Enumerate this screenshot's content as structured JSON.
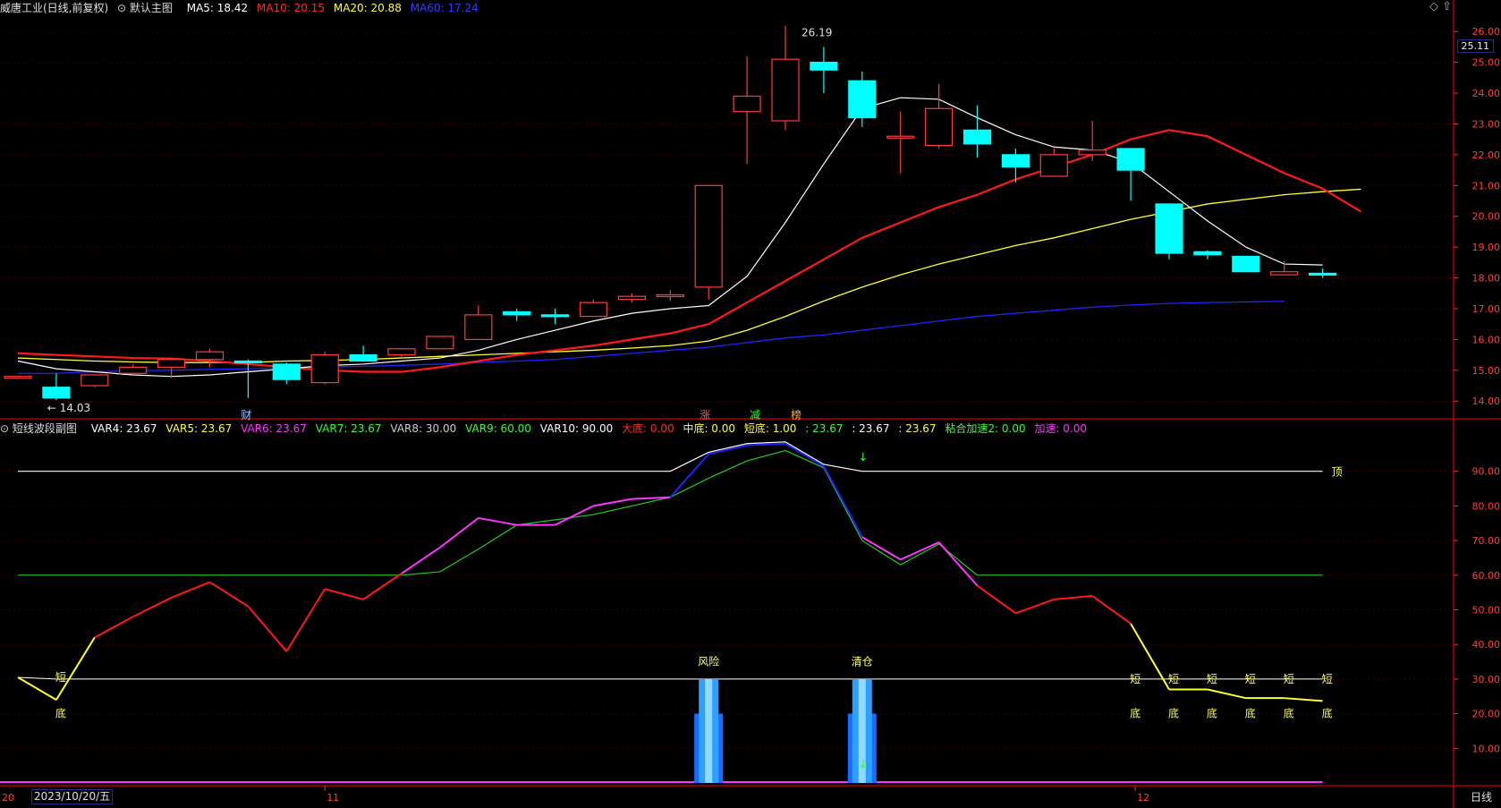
{
  "main_header": {
    "stock_name": "威唐工业(日线,前复权)",
    "template": "默认主图",
    "ma5": "MA5: 18.42",
    "ma10": "MA10: 20.15",
    "ma20": "MA20: 20.88",
    "ma60": "MA60: 17.24"
  },
  "sub_header": {
    "indicator": "短线波段副图",
    "var4": "VAR4: 23.67",
    "var5": "VAR5: 23.67",
    "var6": "VAR6: 23.67",
    "var7": "VAR7: 23.67",
    "var8": "VAR8: 30.00",
    "var9": "VAR9: 60.00",
    "var10": "VAR10: 90.00",
    "dadi": "大底: 0.00",
    "zhongdi": "中底: 0.00",
    "duandi": "短底: 1.00",
    "v1": ": 23.67",
    "v2": ": 23.67",
    "v3": ": 23.67",
    "nianhe": "粘合加速2: 0.00",
    "jiasu": "加速: 0.00"
  },
  "current_price": "25.11",
  "date_box": "2023/10/20/五",
  "period": "日线",
  "x_axis_labels": [
    "20",
    "11",
    "12"
  ],
  "price_axis": [
    "26.00",
    "25.00",
    "24.00",
    "23.00",
    "22.00",
    "21.00",
    "20.00",
    "19.00",
    "18.00",
    "17.00",
    "16.00",
    "15.00",
    "14.00"
  ],
  "sub_axis": [
    "90.00",
    "80.00",
    "70.00",
    "60.00",
    "50.00",
    "40.00",
    "30.00",
    "20.00",
    "10.00"
  ],
  "annotations": {
    "high": "26.19",
    "low": "14.03",
    "cai": "财",
    "zhang": "涨",
    "jian": "减",
    "bang": "榜",
    "ding": "顶",
    "fengxian": "风险",
    "qingcang": "清仓",
    "duan": "短",
    "di": "底"
  },
  "colors": {
    "up": "#ff3b3b",
    "down": "#00ffff",
    "ma5": "#ffffff",
    "ma10": "#ff1a1a",
    "ma20": "#ffff33",
    "ma60": "#2323ff",
    "grid": "#3a0000",
    "axis": "#ff2a2a"
  },
  "chart_data": {
    "type": "candlestick",
    "ylim": [
      13.6,
      26.5
    ],
    "candles": [
      {
        "o": 14.75,
        "h": 14.75,
        "l": 14.75,
        "c": 14.8
      },
      {
        "o": 14.45,
        "h": 14.9,
        "l": 14.03,
        "c": 14.1
      },
      {
        "o": 14.5,
        "h": 14.85,
        "l": 14.45,
        "c": 14.85
      },
      {
        "o": 14.9,
        "h": 15.2,
        "l": 14.85,
        "c": 15.1
      },
      {
        "o": 15.1,
        "h": 15.4,
        "l": 14.75,
        "c": 15.35
      },
      {
        "o": 15.35,
        "h": 15.7,
        "l": 15.1,
        "c": 15.6
      },
      {
        "o": 15.3,
        "h": 15.35,
        "l": 14.1,
        "c": 15.25
      },
      {
        "o": 15.2,
        "h": 15.25,
        "l": 14.55,
        "c": 14.7
      },
      {
        "o": 14.6,
        "h": 15.6,
        "l": 14.55,
        "c": 15.5
      },
      {
        "o": 15.5,
        "h": 15.8,
        "l": 15.3,
        "c": 15.3
      },
      {
        "o": 15.5,
        "h": 15.7,
        "l": 15.4,
        "c": 15.7
      },
      {
        "o": 15.7,
        "h": 16.1,
        "l": 15.7,
        "c": 16.1
      },
      {
        "o": 16.0,
        "h": 17.1,
        "l": 16.0,
        "c": 16.8
      },
      {
        "o": 16.9,
        "h": 17.0,
        "l": 16.6,
        "c": 16.8
      },
      {
        "o": 16.8,
        "h": 17.0,
        "l": 16.5,
        "c": 16.75
      },
      {
        "o": 16.75,
        "h": 17.3,
        "l": 16.75,
        "c": 17.2
      },
      {
        "o": 17.3,
        "h": 17.5,
        "l": 17.2,
        "c": 17.4
      },
      {
        "o": 17.4,
        "h": 17.6,
        "l": 17.25,
        "c": 17.45
      },
      {
        "o": 17.7,
        "h": 21.0,
        "l": 17.3,
        "c": 21.0
      },
      {
        "o": 23.4,
        "h": 25.2,
        "l": 21.7,
        "c": 23.9
      },
      {
        "o": 23.1,
        "h": 26.19,
        "l": 22.8,
        "c": 25.1
      },
      {
        "o": 25.0,
        "h": 25.5,
        "l": 24.0,
        "c": 24.75
      },
      {
        "o": 24.4,
        "h": 24.7,
        "l": 22.9,
        "c": 23.2
      },
      {
        "o": 22.6,
        "h": 23.4,
        "l": 21.4,
        "c": 22.6
      },
      {
        "o": 22.3,
        "h": 24.3,
        "l": 22.2,
        "c": 23.5
      },
      {
        "o": 22.8,
        "h": 23.6,
        "l": 21.9,
        "c": 22.35
      },
      {
        "o": 22.0,
        "h": 22.2,
        "l": 21.1,
        "c": 21.6
      },
      {
        "o": 21.3,
        "h": 22.2,
        "l": 21.3,
        "c": 22.0
      },
      {
        "o": 22.0,
        "h": 23.1,
        "l": 21.8,
        "c": 22.15
      },
      {
        "o": 22.2,
        "h": 22.2,
        "l": 20.5,
        "c": 21.5
      },
      {
        "o": 20.4,
        "h": 20.4,
        "l": 18.6,
        "c": 18.8
      },
      {
        "o": 18.85,
        "h": 18.9,
        "l": 18.6,
        "c": 18.75
      },
      {
        "o": 18.7,
        "h": 18.7,
        "l": 18.2,
        "c": 18.2
      },
      {
        "o": 18.1,
        "h": 18.55,
        "l": 18.1,
        "c": 18.2
      },
      {
        "o": 18.15,
        "h": 18.3,
        "l": 18.0,
        "c": 18.1
      }
    ],
    "ma5": [
      15.3,
      15.05,
      14.95,
      14.85,
      14.8,
      14.85,
      14.95,
      15.05,
      15.15,
      15.2,
      15.3,
      15.4,
      15.65,
      16.0,
      16.3,
      16.6,
      16.85,
      17.0,
      17.1,
      18.05,
      19.8,
      21.7,
      23.5,
      23.85,
      23.8,
      23.2,
      22.65,
      22.25,
      22.15,
      21.75,
      20.8,
      19.85,
      19.0,
      18.45,
      18.42
    ],
    "ma10": [
      15.55,
      15.5,
      15.45,
      15.4,
      15.38,
      15.3,
      15.2,
      15.1,
      15.0,
      14.95,
      14.95,
      15.1,
      15.3,
      15.5,
      15.65,
      15.8,
      16.0,
      16.2,
      16.5,
      17.2,
      17.9,
      18.6,
      19.3,
      19.8,
      20.3,
      20.7,
      21.2,
      21.6,
      22.0,
      22.5,
      22.8,
      22.6,
      22.0,
      21.4,
      20.9,
      20.15
    ],
    "ma20": [
      15.4,
      15.35,
      15.3,
      15.27,
      15.25,
      15.25,
      15.25,
      15.3,
      15.32,
      15.35,
      15.4,
      15.45,
      15.5,
      15.55,
      15.6,
      15.65,
      15.72,
      15.8,
      15.95,
      16.3,
      16.75,
      17.25,
      17.7,
      18.1,
      18.45,
      18.75,
      19.05,
      19.3,
      19.6,
      19.9,
      20.15,
      20.4,
      20.55,
      20.7,
      20.8,
      20.88
    ],
    "ma60": [
      14.9,
      14.9,
      14.95,
      14.98,
      15.0,
      15.03,
      15.05,
      15.08,
      15.1,
      15.13,
      15.16,
      15.2,
      15.25,
      15.3,
      15.35,
      15.45,
      15.55,
      15.65,
      15.75,
      15.9,
      16.05,
      16.15,
      16.3,
      16.45,
      16.6,
      16.75,
      16.85,
      16.95,
      17.05,
      17.12,
      17.17,
      17.2,
      17.22,
      17.24
    ],
    "sub_ylim": [
      0,
      100
    ],
    "sub_var_main": [
      30.5,
      24,
      42,
      48,
      53.5,
      58,
      51,
      38,
      56,
      53,
      60.5,
      68,
      76.5,
      74.5,
      74.5,
      80,
      82,
      82.5,
      95,
      97.5,
      98,
      91.5,
      71,
      64.5,
      69.5,
      57,
      49,
      53,
      54,
      46,
      27,
      27,
      24.5,
      24.5,
      23.67
    ],
    "sub_var9": [
      60,
      60,
      60,
      60,
      60,
      60,
      60,
      60,
      60,
      60,
      60,
      61,
      67.5,
      74.5,
      76,
      77.5,
      80,
      82.5,
      88,
      93,
      96,
      91,
      70,
      63,
      69,
      60,
      60,
      60,
      60,
      60,
      60,
      60,
      60,
      60,
      60
    ],
    "sub_var10": [
      90,
      90,
      90,
      90,
      90,
      90,
      90,
      90,
      90,
      90,
      90,
      90,
      90,
      90,
      90,
      90,
      90,
      90,
      95.5,
      98,
      98.5,
      92,
      90,
      90,
      90,
      90,
      90,
      90,
      90,
      90,
      90,
      90,
      90,
      90,
      90
    ],
    "sub_var8": [
      30.5,
      30,
      30,
      30,
      30,
      30,
      30,
      30,
      30,
      30,
      30,
      30,
      30,
      30,
      30,
      30,
      30,
      30,
      30,
      30,
      30,
      30,
      30,
      30,
      30,
      30,
      30,
      30,
      30,
      30,
      30,
      30,
      30,
      30,
      30
    ],
    "bars": [
      {
        "index": 18,
        "value": 30
      },
      {
        "index": 22,
        "value": 30
      }
    ]
  }
}
